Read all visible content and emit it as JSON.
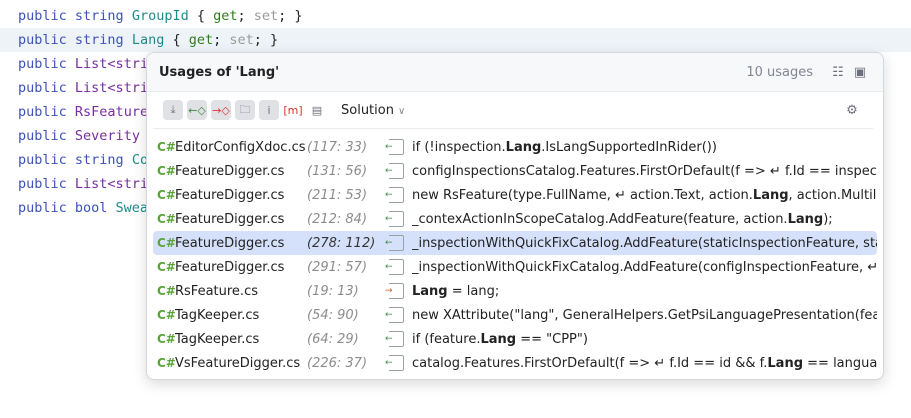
{
  "editor": {
    "lines": [
      {
        "kw": "public string",
        "type": "",
        "name": "GroupId",
        "rest": [
          " { ",
          "get",
          "; ",
          "set",
          "; }"
        ]
      },
      {
        "kw": "public string",
        "type": "",
        "name": "Lang",
        "rest": [
          " { ",
          "get",
          "; ",
          "set",
          "; }"
        ]
      },
      {
        "kw": "public",
        "type": "List<stri",
        "name": "",
        "rest": []
      },
      {
        "kw": "public",
        "type": "List<stri",
        "name": "",
        "rest": []
      },
      {
        "kw": "public",
        "type": "RsFeature",
        "name": "",
        "rest": []
      },
      {
        "kw": "public",
        "type": "Severity",
        "name": "",
        "rest": []
      },
      {
        "kw": "public string",
        "type": "",
        "name": "Co",
        "rest": []
      },
      {
        "kw": "public",
        "type": "List<stri",
        "name": "",
        "rest": []
      },
      {
        "kw": "public bool",
        "type": "",
        "name": "Swea",
        "rest": []
      }
    ]
  },
  "popup": {
    "title": "Usages of 'Lang'",
    "count": "10 usages",
    "icons": [
      "group-icon",
      "pin-icon"
    ],
    "toolbar": {
      "buttons": [
        "merge",
        "read",
        "write",
        "folder",
        "info",
        "[m]",
        "preview"
      ],
      "scope": "Solution",
      "settings": "gear-icon"
    },
    "rows": [
      {
        "file": "EditorConfigXdoc.cs",
        "loc": "(117: 33)",
        "pre": "if (!inspection.",
        "bold": "Lang",
        "post": ".IsLangSupportedInRider())",
        "kind": "read"
      },
      {
        "file": "FeatureDigger.cs",
        "loc": "(131: 56)",
        "pre": "configInspectionsCatalog.Features.FirstOrDefault(f => ↵ f.Id == inspectio",
        "bold": "",
        "post": "",
        "kind": "read"
      },
      {
        "file": "FeatureDigger.cs",
        "loc": "(211: 53)",
        "pre": "new RsFeature(type.FullName, ↵ action.Text, action.",
        "bold": "Lang",
        "post": ", action.Multilan",
        "kind": "read"
      },
      {
        "file": "FeatureDigger.cs",
        "loc": "(212: 84)",
        "pre": "_contexActionInScopeCatalog.AddFeature(feature, action.",
        "bold": "Lang",
        "post": ");",
        "kind": "read"
      },
      {
        "file": "FeatureDigger.cs",
        "loc": "(278: 112)",
        "pre": "_inspectionWithQuickFixCatalog.AddFeature(staticInspectionFeature, stati",
        "bold": "",
        "post": "",
        "kind": "read",
        "selected": true
      },
      {
        "file": "FeatureDigger.cs",
        "loc": "(291: 57)",
        "pre": "_inspectionWithQuickFixCatalog.AddFeature(configInspectionFeature, ↵ c",
        "bold": "",
        "post": "",
        "kind": "read"
      },
      {
        "file": "RsFeature.cs",
        "loc": "(19: 13)",
        "pre": "",
        "bold": "Lang",
        "post": " = lang;",
        "kind": "write"
      },
      {
        "file": "TagKeeper.cs",
        "loc": "(54: 90)",
        "pre": "new XAttribute(\"lang\", GeneralHelpers.GetPsiLanguagePresentation(featu",
        "bold": "",
        "post": "",
        "kind": "read"
      },
      {
        "file": "TagKeeper.cs",
        "loc": "(64: 29)",
        "pre": "if (feature.",
        "bold": "Lang",
        "post": " == \"CPP\")",
        "kind": "read"
      },
      {
        "file": "VsFeatureDigger.cs",
        "loc": "(226: 37)",
        "pre": "catalog.Features.FirstOrDefault(f => ↵ f.Id == id && f.",
        "bold": "Lang",
        "post": " == language)",
        "kind": "read"
      }
    ]
  },
  "labels": {
    "cs": "C#"
  }
}
